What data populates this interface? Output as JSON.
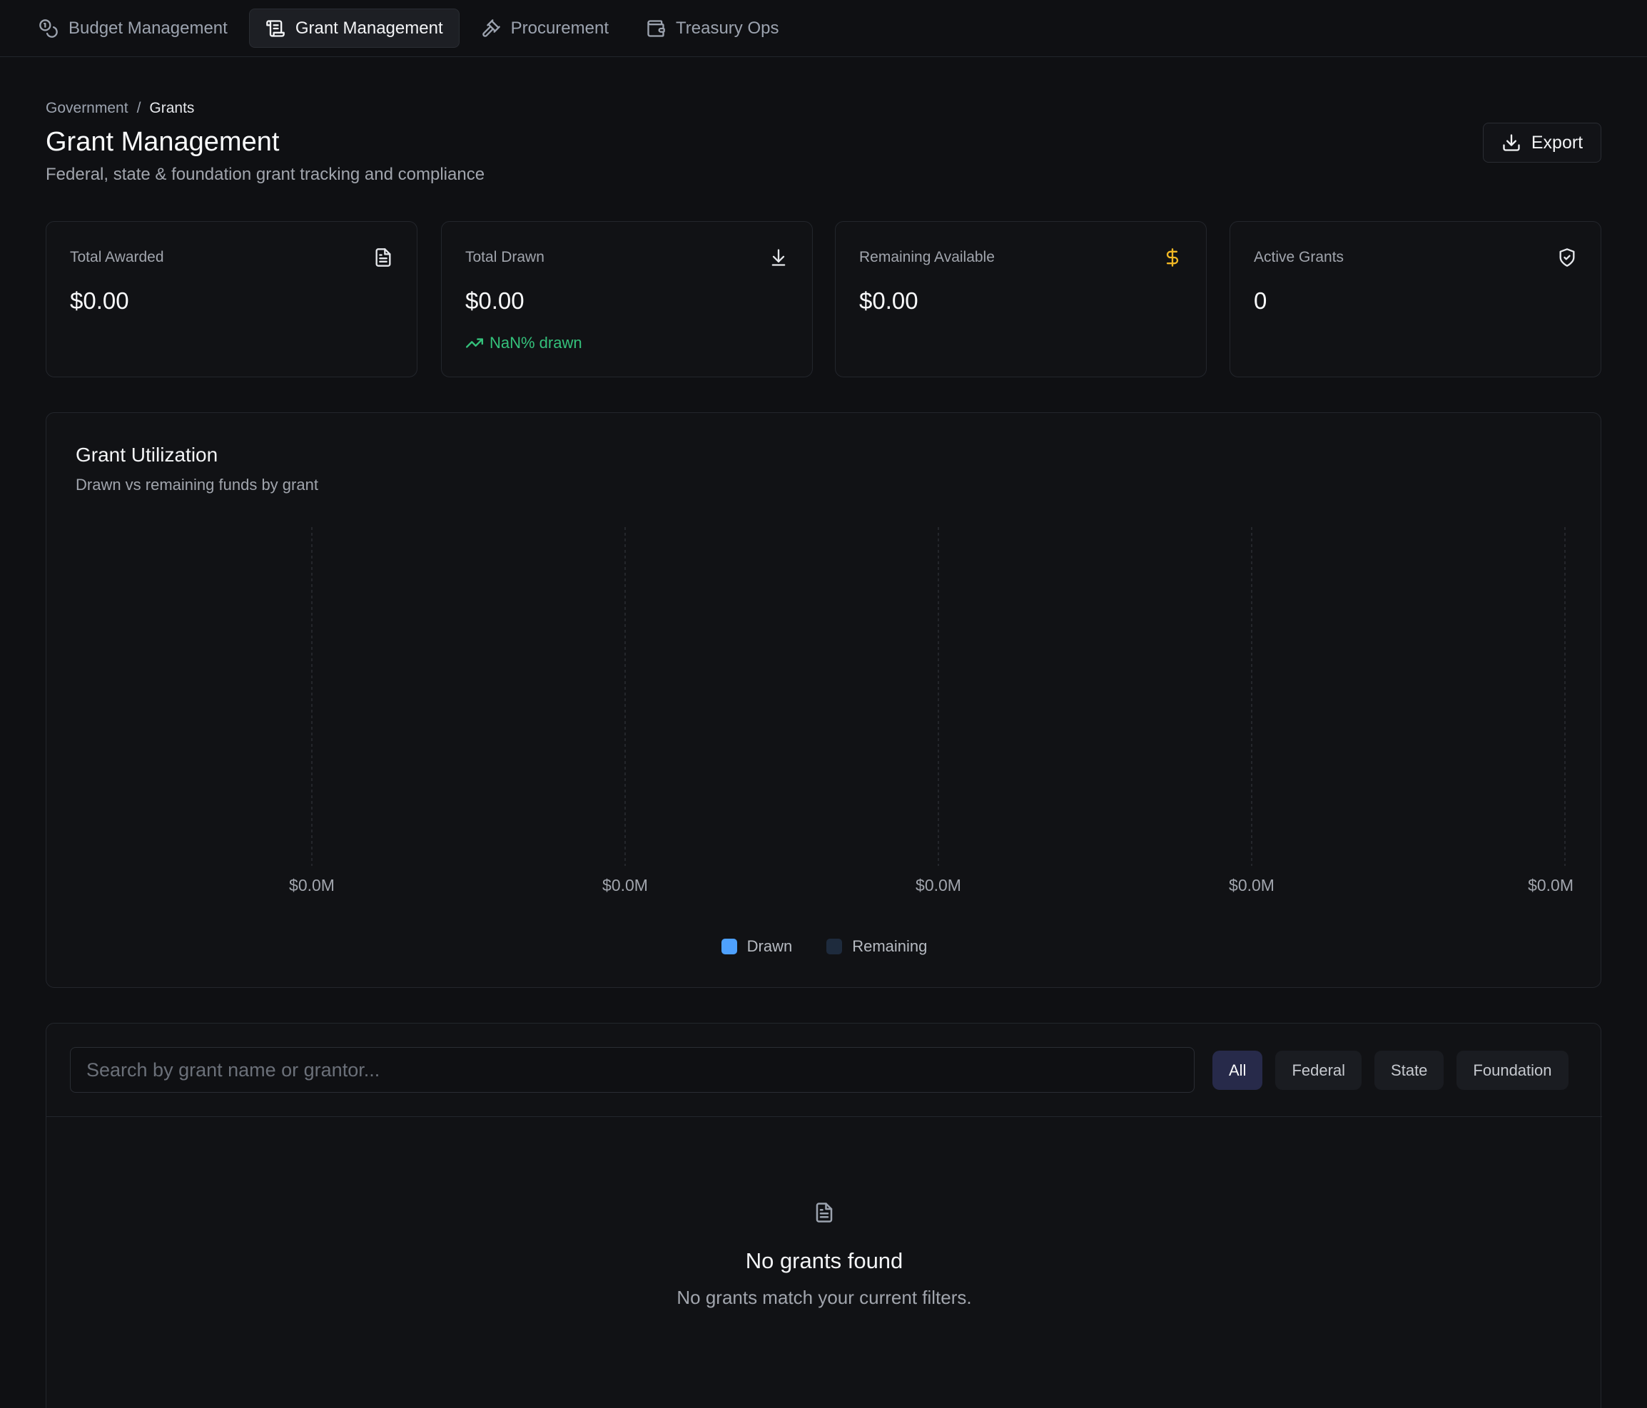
{
  "nav": {
    "tabs": [
      {
        "label": "Budget Management",
        "icon": "coins-icon",
        "active": false
      },
      {
        "label": "Grant Management",
        "icon": "scroll-icon",
        "active": true
      },
      {
        "label": "Procurement",
        "icon": "gavel-icon",
        "active": false
      },
      {
        "label": "Treasury Ops",
        "icon": "wallet-icon",
        "active": false
      }
    ]
  },
  "breadcrumb": {
    "parent": "Government",
    "separator": "/",
    "current": "Grants"
  },
  "header": {
    "title": "Grant Management",
    "subtitle": "Federal, state & foundation grant tracking and compliance",
    "export_label": "Export"
  },
  "stats": [
    {
      "label": "Total Awarded",
      "value": "$0.00",
      "icon": "file-text-icon"
    },
    {
      "label": "Total Drawn",
      "value": "$0.00",
      "icon": "download-icon",
      "trend": "NaN% drawn"
    },
    {
      "label": "Remaining Available",
      "value": "$0.00",
      "icon": "dollar-icon"
    },
    {
      "label": "Active Grants",
      "value": "0",
      "icon": "shield-check-icon"
    }
  ],
  "chart": {
    "title": "Grant Utilization",
    "subtitle": "Drawn vs remaining funds by grant",
    "legend": {
      "drawn": "Drawn",
      "remaining": "Remaining"
    }
  },
  "chart_data": {
    "type": "bar",
    "orientation": "horizontal",
    "stacked": true,
    "categories": [],
    "series": [
      {
        "name": "Drawn",
        "values": [],
        "color": "#4ea1ff"
      },
      {
        "name": "Remaining",
        "values": [],
        "color": "#1e2b3d"
      }
    ],
    "x_tick_labels": [
      "$0.0M",
      "$0.0M",
      "$0.0M",
      "$0.0M",
      "$0.0M"
    ],
    "xlim": [
      0,
      0
    ],
    "grid": true,
    "legend_position": "bottom-center"
  },
  "filters": {
    "search_placeholder": "Search by grant name or grantor...",
    "chips": [
      {
        "label": "All",
        "active": true
      },
      {
        "label": "Federal",
        "active": false
      },
      {
        "label": "State",
        "active": false
      },
      {
        "label": "Foundation",
        "active": false
      }
    ]
  },
  "empty": {
    "icon": "file-text-icon",
    "title": "No grants found",
    "description": "No grants match your current filters."
  },
  "colors": {
    "background": "#0f1013",
    "card": "#111215",
    "accent_green": "#34c17b",
    "accent_yellow": "#f2b824",
    "drawn": "#4ea1ff",
    "remaining": "#1e2b3d",
    "chip_active": "#272a4a"
  }
}
